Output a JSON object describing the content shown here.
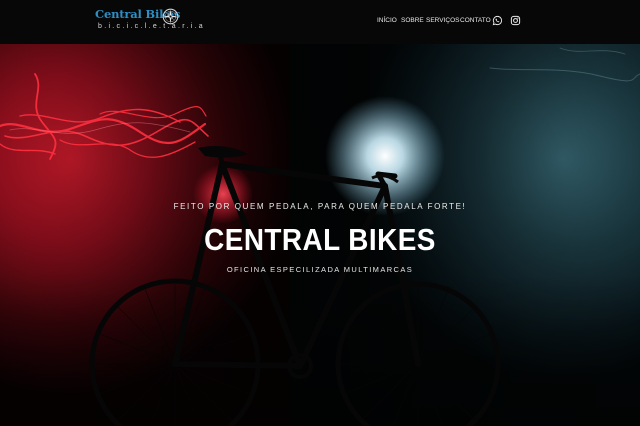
{
  "header": {
    "logo": {
      "name": "Central Bikes",
      "tagline": "b.i.c.i.c.l.e.t.a.r.i.a"
    },
    "nav": {
      "items": [
        {
          "label": "INÍCIO"
        },
        {
          "label": "SOBRE"
        },
        {
          "label": "SERVIÇOS"
        },
        {
          "label": "CONTATO"
        }
      ],
      "icons": [
        "whatsapp-icon",
        "instagram-icon"
      ]
    }
  },
  "hero": {
    "kicker": "FEITO POR QUEM PEDALA, PARA QUEM PEDALA FORTE!",
    "title": "CENTRAL BIKES",
    "subtitle": "OFICINA ESPECILIZADA MULTIMARCAS"
  },
  "colors": {
    "logo_blue": "#2f8fc4",
    "topbar": "#070707",
    "red_light": "#e0102a",
    "blue_light": "#a8d8ee"
  }
}
